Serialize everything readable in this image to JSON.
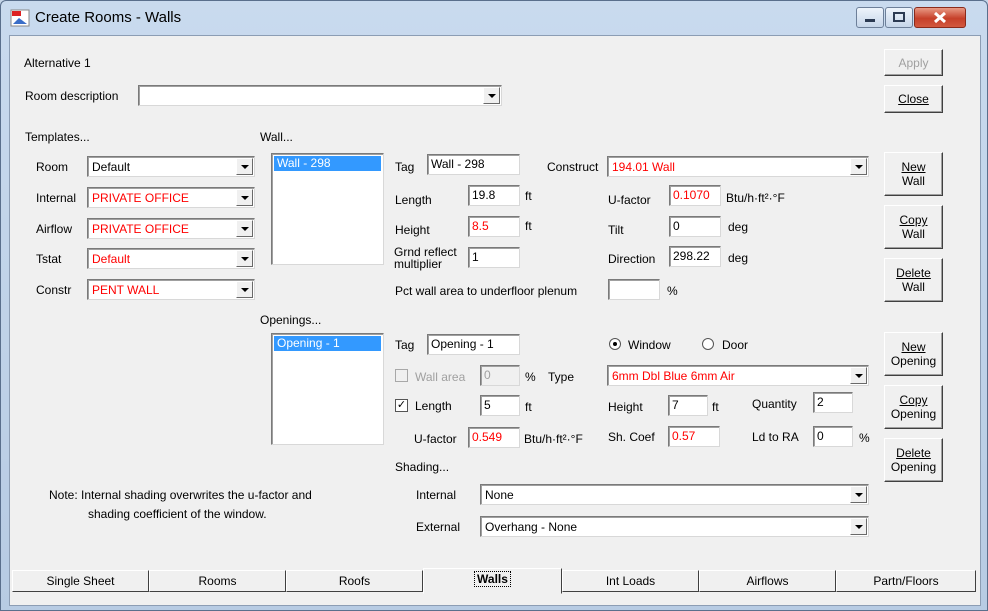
{
  "window": {
    "title": "Create Rooms - Walls"
  },
  "header": {
    "alternative": "Alternative 1",
    "room_description_label": "Room description",
    "room_description_value": "",
    "apply_label": "Apply",
    "close_label": "Close"
  },
  "templates": {
    "heading": "Templates...",
    "rows": [
      {
        "label": "Room",
        "value": "Default",
        "color": "#000000"
      },
      {
        "label": "Internal",
        "value": "PRIVATE OFFICE",
        "color": "#ff0000"
      },
      {
        "label": "Airflow",
        "value": "PRIVATE OFFICE",
        "color": "#ff0000"
      },
      {
        "label": "Tstat",
        "value": "Default",
        "color": "#ff0000"
      },
      {
        "label": "Constr",
        "value": "PENT WALL",
        "color": "#ff0000"
      }
    ]
  },
  "wall": {
    "heading": "Wall...",
    "list": [
      "Wall - 298"
    ],
    "tag_label": "Tag",
    "tag_value": "Wall - 298",
    "construct_label": "Construct",
    "construct_value": "194.01 Wall",
    "length_label": "Length",
    "length_value": "19.8",
    "length_unit": "ft",
    "height_label": "Height",
    "height_value": "8.5",
    "height_unit": "ft",
    "grnd_label_1": "Grnd reflect",
    "grnd_label_2": "multiplier",
    "grnd_value": "1",
    "ufactor_label": "U-factor",
    "ufactor_value": "0.1070",
    "ufactor_unit": "Btu/h·ft²·°F",
    "tilt_label": "Tilt",
    "tilt_value": "0",
    "tilt_unit": "deg",
    "direction_label": "Direction",
    "direction_value": "298.22",
    "direction_unit": "deg",
    "plenum_label": "Pct wall area to underfloor plenum",
    "plenum_value": "",
    "plenum_unit": "%",
    "new_1": "New",
    "new_2": "Wall",
    "copy_1": "Copy",
    "copy_2": "Wall",
    "delete_1": "Delete",
    "delete_2": "Wall"
  },
  "openings": {
    "heading": "Openings...",
    "list": [
      "Opening - 1"
    ],
    "tag_label": "Tag",
    "tag_value": "Opening - 1",
    "window_label": "Window",
    "door_label": "Door",
    "wall_area_label": "Wall area",
    "wall_area_value": "0",
    "wall_area_unit": "%",
    "type_label": "Type",
    "type_value": "6mm Dbl Blue 6mm Air",
    "length_label": "Length",
    "length_value": "5",
    "length_unit": "ft",
    "height_label": "Height",
    "height_value": "7",
    "height_unit": "ft",
    "quantity_label": "Quantity",
    "quantity_value": "2",
    "ufactor_label": "U-factor",
    "ufactor_value": "0.549",
    "ufactor_unit": "Btu/h·ft²·°F",
    "shcoef_label": "Sh. Coef",
    "shcoef_value": "0.57",
    "ldra_label": "Ld to RA",
    "ldra_value": "0",
    "ldra_unit": "%",
    "new_1": "New",
    "new_2": "Opening",
    "copy_1": "Copy",
    "copy_2": "Opening",
    "delete_1": "Delete",
    "delete_2": "Opening"
  },
  "shading": {
    "heading": "Shading...",
    "internal_label": "Internal",
    "internal_value": "None",
    "external_label": "External",
    "external_value": "Overhang - None",
    "note_1": "Note:  Internal shading overwrites the u-factor and",
    "note_2": "shading coefficient of the window."
  },
  "tabs": [
    {
      "label": "Single Sheet"
    },
    {
      "label": "Rooms"
    },
    {
      "label": "Roofs"
    },
    {
      "label": "Walls"
    },
    {
      "label": "Int Loads"
    },
    {
      "label": "Airflows"
    },
    {
      "label": "Partn/Floors"
    }
  ],
  "colors": {
    "highlight": "#3399ff",
    "override_text": "#ff0000"
  }
}
